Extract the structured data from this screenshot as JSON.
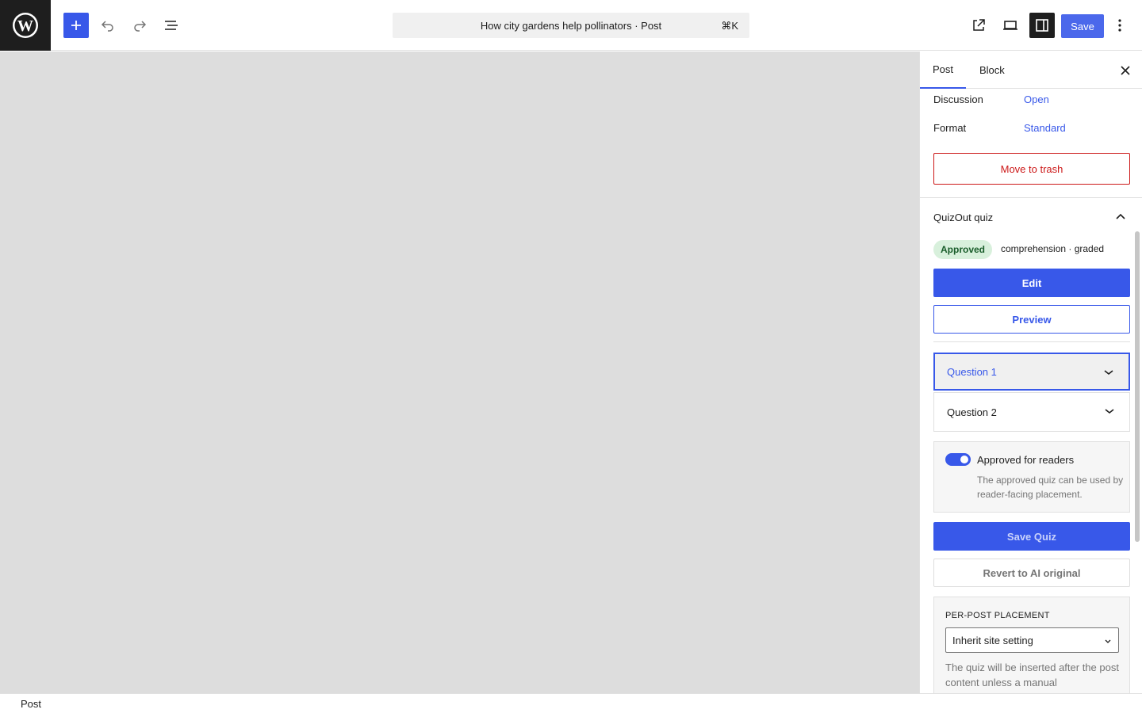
{
  "topbar": {
    "document_title": "How city gardens help pollinators · Post",
    "shortcut": "⌘K",
    "save_label": "Save",
    "icons": [
      "wordpress-logo",
      "plus-icon",
      "undo-icon",
      "redo-icon",
      "list-view-icon",
      "external-link-icon",
      "desktop-icon",
      "sidebar-icon",
      "more-vertical-icon"
    ]
  },
  "sidebar": {
    "tabs": [
      {
        "label": "Post"
      },
      {
        "label": "Block"
      }
    ],
    "discussion": {
      "label": "Discussion",
      "value": "Open"
    },
    "format": {
      "label": "Format",
      "value": "Standard"
    },
    "trash_label": "Move to trash",
    "quiz": {
      "title": "QuizOut quiz",
      "badge": "Approved",
      "meta": "comprehension · graded",
      "edit_label": "Edit",
      "preview_label": "Preview",
      "questions": [
        {
          "label": "Question 1"
        },
        {
          "label": "Question 2"
        }
      ],
      "toggle_label": "Approved for readers",
      "toggle_help": "The approved quiz can be used by reader-facing placement.",
      "save_label": "Save Quiz",
      "revert_label": "Revert to AI original",
      "placement": {
        "title": "Per-post placement",
        "select_value": "Inherit site setting",
        "help": "The quiz will be inserted after the post content unless a manual"
      }
    }
  },
  "footer": {
    "breadcrumb": "Post"
  },
  "colors": {
    "accent": "#3858e9",
    "danger": "#cc1818",
    "badge_bg": "#d8f0dc",
    "canvas": "#dddddd"
  }
}
